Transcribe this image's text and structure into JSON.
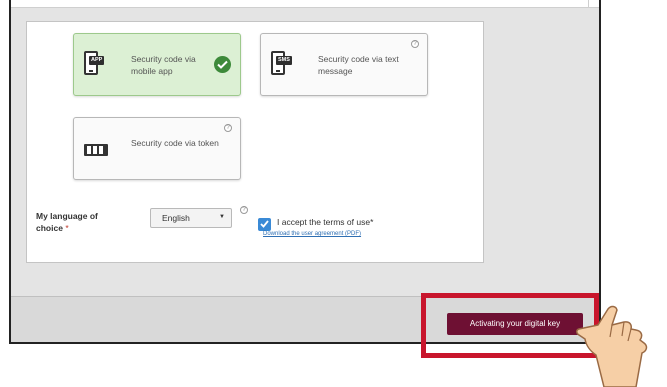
{
  "options": [
    {
      "label": "Security code via mobile app",
      "tag": "APP",
      "selected": true
    },
    {
      "label": "Security code via text message",
      "tag": "SMS",
      "selected": false
    },
    {
      "label": "Security code via token",
      "selected": false
    }
  ],
  "help_glyph": "?",
  "language": {
    "label": "My language of choice",
    "required_mark": "*",
    "selected": "English",
    "caret": "▼"
  },
  "terms": {
    "checked": true,
    "text": "I accept the terms of use*",
    "link": "Download the user agreement (PDF)"
  },
  "action_button": "Activating your digital key",
  "colors": {
    "primary_button": "#6e1033",
    "highlight": "#c8152c",
    "selected_bg": "#dcf0d4",
    "checkbox": "#3a8ad6"
  }
}
